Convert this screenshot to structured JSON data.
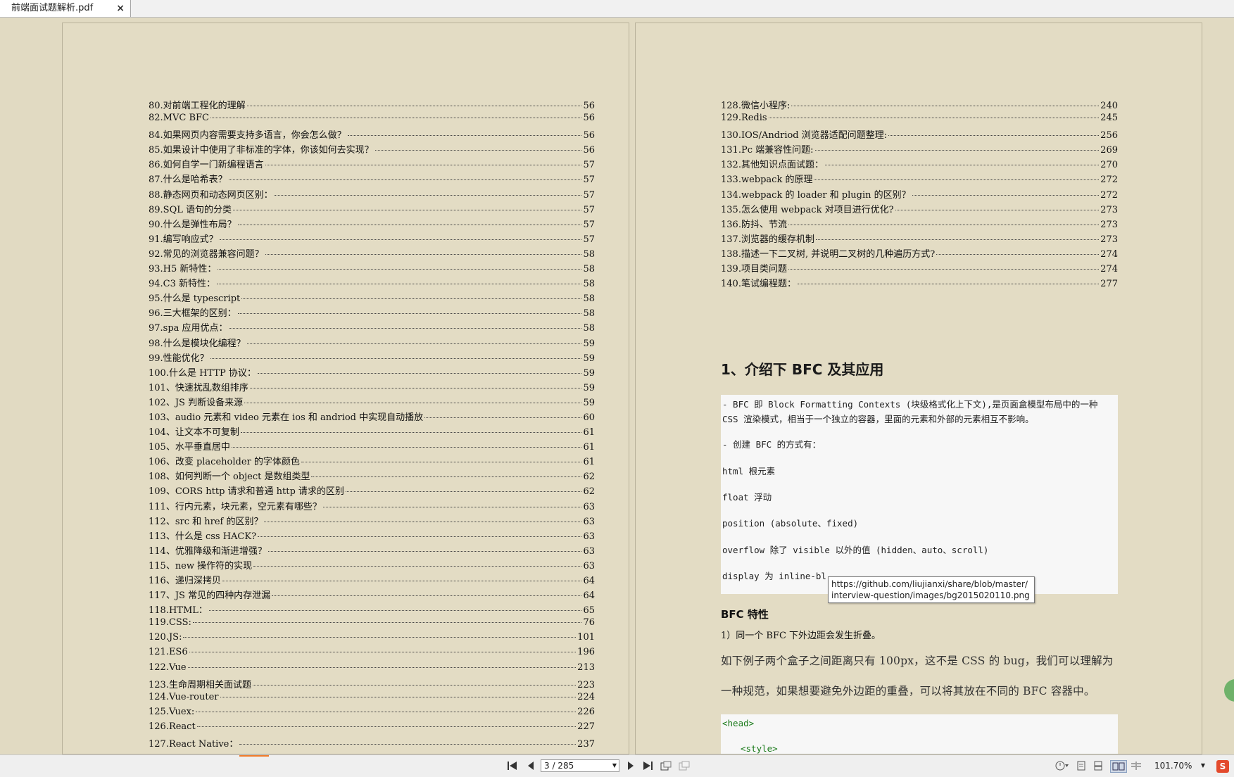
{
  "tab": {
    "title": "前端面试题解析.pdf",
    "close_icon": "×"
  },
  "left_toc": [
    {
      "t": "80.对前端工程化的理解",
      "p": "56"
    },
    {
      "t": "82.MVC BFC",
      "p": "56"
    },
    {
      "t": "84.如果网页内容需要支持多语言，你会怎么做？",
      "p": "56"
    },
    {
      "t": "85.如果设计中使用了非标准的字体，你该如何去实现？",
      "p": "56"
    },
    {
      "t": "86.如何自学一门新编程语言",
      "p": "57"
    },
    {
      "t": "87.什么是哈希表？",
      "p": "57"
    },
    {
      "t": "88.静态网页和动态网页区别：",
      "p": "57"
    },
    {
      "t": "89.SQL 语句的分类",
      "p": "57"
    },
    {
      "t": "90.什么是弹性布局？",
      "p": "57"
    },
    {
      "t": "91.编写响应式？",
      "p": "57"
    },
    {
      "t": "92.常见的浏览器兼容问题？",
      "p": "58"
    },
    {
      "t": "93.H5 新特性：",
      "p": "58"
    },
    {
      "t": "94.C3 新特性：",
      "p": "58"
    },
    {
      "t": "95.什么是 typescript",
      "p": "58"
    },
    {
      "t": "96.三大框架的区别：",
      "p": "58"
    },
    {
      "t": "97.spa 应用优点：",
      "p": "58"
    },
    {
      "t": "98.什么是模块化编程？",
      "p": "59"
    },
    {
      "t": "99.性能优化？",
      "p": "59"
    },
    {
      "t": "100.什么是 HTTP 协议：",
      "p": "59"
    },
    {
      "t": "101、快速扰乱数组排序",
      "p": "59"
    },
    {
      "t": "102、JS 判断设备来源",
      "p": "59"
    },
    {
      "t": "103、audio 元素和 video 元素在 ios 和 andriod 中实现自动播放",
      "p": "60"
    },
    {
      "t": "104、让文本不可复制",
      "p": "61"
    },
    {
      "t": "105、水平垂直居中",
      "p": "61"
    },
    {
      "t": "106、改变 placeholder 的字体颜色",
      "p": "61"
    },
    {
      "t": "108、如何判断一个 object 是数组类型",
      "p": "62"
    },
    {
      "t": "109、CORS http 请求和普通 http 请求的区别",
      "p": "62"
    },
    {
      "t": "111、行内元素，块元素，空元素有哪些？",
      "p": "63"
    },
    {
      "t": "112、src 和 href 的区别？",
      "p": "63"
    },
    {
      "t": "113、什么是 css HACK?",
      "p": "63"
    },
    {
      "t": "114、优雅降级和渐进增强？",
      "p": "63"
    },
    {
      "t": "115、new 操作符的实现",
      "p": "63"
    },
    {
      "t": "116、递归深拷贝",
      "p": "64"
    },
    {
      "t": "117、JS 常见的四种内存泄漏",
      "p": "64"
    },
    {
      "t": "118.HTML：",
      "p": "65"
    },
    {
      "t": "119.CSS:",
      "p": "76"
    },
    {
      "t": "120.JS:",
      "p": "101"
    },
    {
      "t": "121.ES6",
      "p": "196"
    },
    {
      "t": "122.Vue",
      "p": "213"
    },
    {
      "t": "123.生命周期相关面试题",
      "p": "223"
    },
    {
      "t": "124.Vue-router",
      "p": "224"
    },
    {
      "t": "125.Vuex:",
      "p": "226"
    },
    {
      "t": "126.React",
      "p": "227"
    },
    {
      "t": "127.React Native：",
      "p": "237"
    }
  ],
  "right_toc": [
    {
      "t": "128.微信小程序:",
      "p": "240"
    },
    {
      "t": "129.Redis",
      "p": "245"
    },
    {
      "t": "130.IOS/Andriod 浏览器适配问题整理:",
      "p": "256"
    },
    {
      "t": "131.Pc 端兼容性问题:",
      "p": "269"
    },
    {
      "t": "132.其他知识点面试题：",
      "p": "270"
    },
    {
      "t": "133.webpack 的原理",
      "p": "272"
    },
    {
      "t": "134.webpack 的 loader 和 plugin 的区别？",
      "p": "272"
    },
    {
      "t": "135.怎么使用 webpack 对项目进行优化?",
      "p": "273"
    },
    {
      "t": "136.防抖、节流",
      "p": "273"
    },
    {
      "t": "137.浏览器的缓存机制",
      "p": "273"
    },
    {
      "t": "138.描述一下二叉树, 并说明二叉树的几种遍历方式?",
      "p": "274"
    },
    {
      "t": "139.项目类问题",
      "p": "274"
    },
    {
      "t": "140.笔试编程题：",
      "p": "277"
    }
  ],
  "section": {
    "heading": "1、介绍下 BFC 及其应用",
    "code1": {
      "l1": "- BFC 即 Block Formatting Contexts (块级格式化上下文),是页面盒模型布局中的一种",
      "l2": "CSS 渲染模式，相当于一个独立的容器，里面的元素和外部的元素相互不影响。",
      "l3": "- 创建 BFC 的方式有：",
      "l4": "html 根元素",
      "l5": "float 浮动",
      "l6": "position (absolute、fixed)",
      "l7": "overflow 除了 visible 以外的值 (hidden、auto、scroll)",
      "l8": "display 为 inline-bl"
    },
    "tooltip": {
      "line1": "https://github.com/liujianxi/share/blob/master/",
      "line2": "interview-question/images/bg2015020110.png"
    },
    "sub_heading": "BFC 特性",
    "p1": "1）同一个 BFC 下外边距会发生折叠。",
    "p2": "如下例子两个盒子之间距离只有 100px，这不是 CSS 的 bug，我们可以理解为",
    "p3": "一种规范，如果想要避免外边距的重叠，可以将其放在不同的 BFC 容器中。",
    "code2": {
      "l1": "<head>",
      "l2": "<style>"
    }
  },
  "toolbar": {
    "page_indicator": "3 / 285",
    "zoom": "101.70%",
    "icons": [
      "first-page-icon",
      "prev-page-icon",
      "next-page-icon",
      "last-page-icon"
    ]
  },
  "colors": {
    "page_bg": "#e3dcc4",
    "accent": "#f07b2a"
  }
}
